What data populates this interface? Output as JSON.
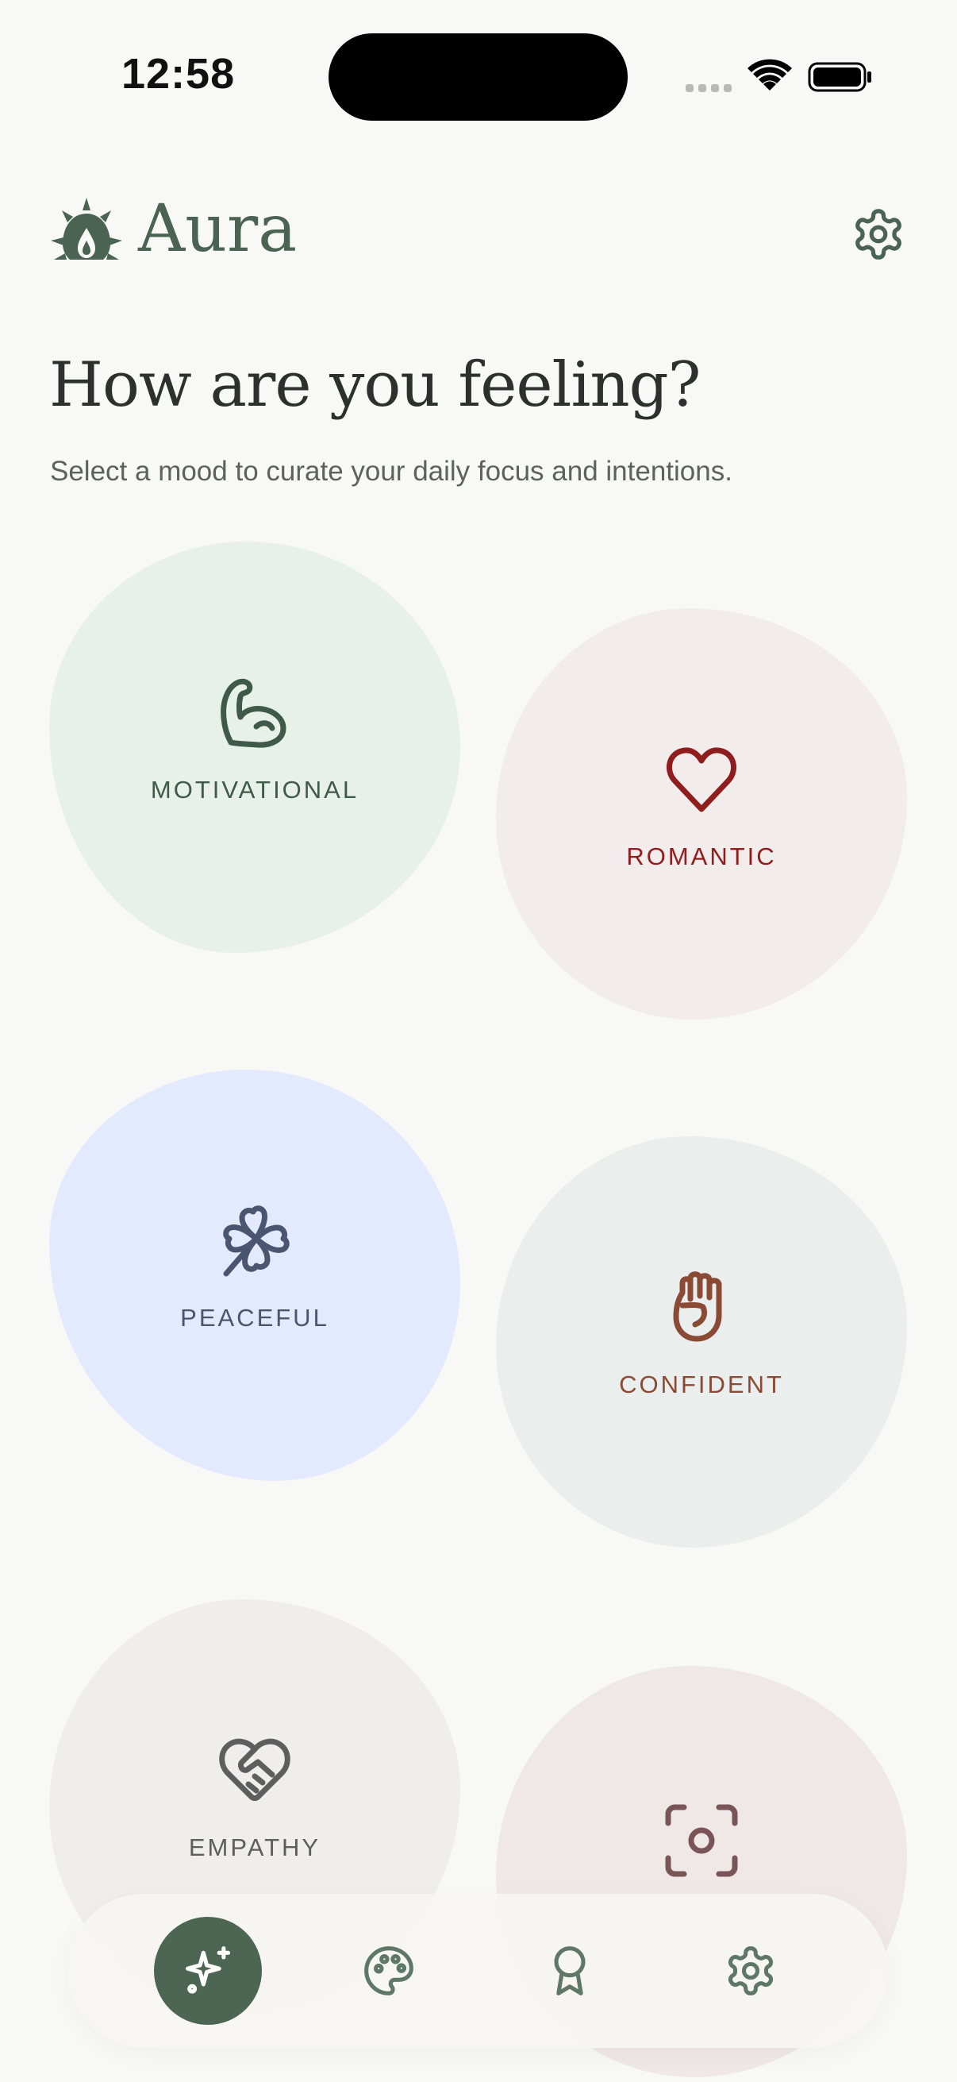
{
  "status_bar": {
    "time": "12:58",
    "icons": [
      "signal-dots-icon",
      "wifi-icon",
      "battery-icon"
    ]
  },
  "header": {
    "app_name": "Aura",
    "logo_icon": "sun-flame-logo-icon",
    "settings_icon": "gear-icon"
  },
  "main": {
    "title": "How are you feeling?",
    "subtitle": "Select a mood to curate your daily focus and intentions."
  },
  "moods": [
    {
      "label": "MOTIVATIONAL",
      "icon": "flexed-bicep-icon",
      "color": "#3f5a48"
    },
    {
      "label": "ROMANTIC",
      "icon": "heart-icon",
      "color": "#8f1d1d"
    },
    {
      "label": "PEACEFUL",
      "icon": "clover-icon",
      "color": "#4a5670"
    },
    {
      "label": "CONFIDENT",
      "icon": "raised-fist-icon",
      "color": "#8a4a35"
    },
    {
      "label": "EMPATHY",
      "icon": "heart-handshake-icon",
      "color": "#5c5f5d"
    },
    {
      "label": "",
      "icon": "focus-frame-icon",
      "color": "#7a5558"
    }
  ],
  "bottom_nav": {
    "items": [
      {
        "icon": "sparkles-icon",
        "active": true
      },
      {
        "icon": "palette-icon",
        "active": false
      },
      {
        "icon": "award-ribbon-icon",
        "active": false
      },
      {
        "icon": "gear-icon",
        "active": false
      }
    ],
    "accent": "#4c6653",
    "icon_color": "#5e7767"
  }
}
